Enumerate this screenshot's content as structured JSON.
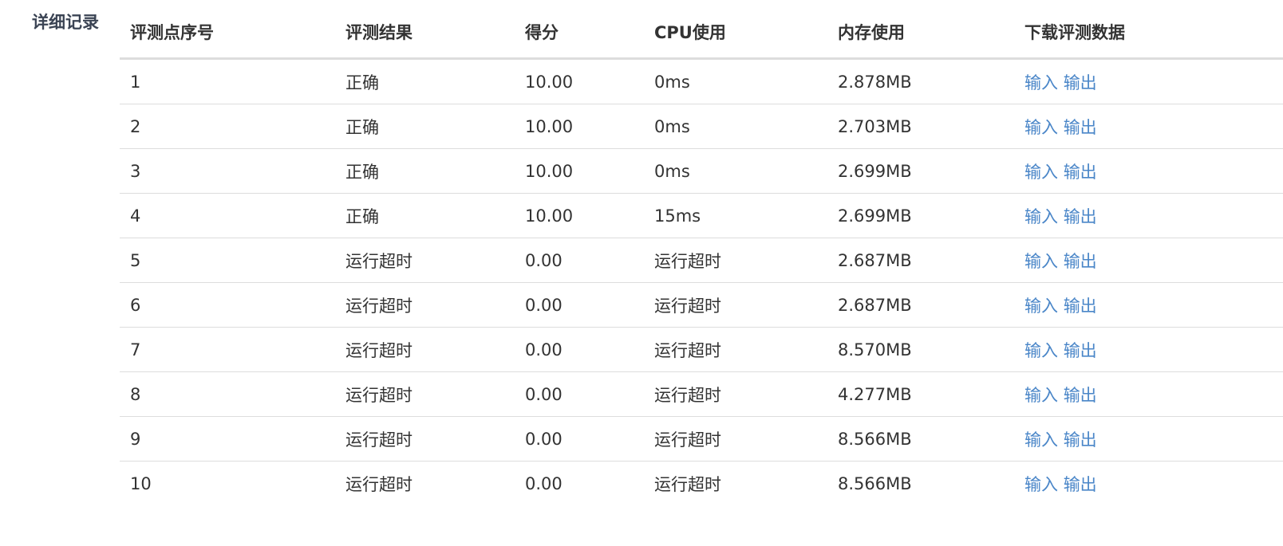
{
  "section_label": "详细记录",
  "link_color": "#4a86c8",
  "table": {
    "headers": [
      "评测点序号",
      "评测结果",
      "得分",
      "CPU使用",
      "内存使用",
      "下载评测数据"
    ],
    "input_label": "输入",
    "output_label": "输出",
    "rows": [
      {
        "index": "1",
        "result": "正确",
        "score": "10.00",
        "cpu": "0ms",
        "memory": "2.878MB"
      },
      {
        "index": "2",
        "result": "正确",
        "score": "10.00",
        "cpu": "0ms",
        "memory": "2.703MB"
      },
      {
        "index": "3",
        "result": "正确",
        "score": "10.00",
        "cpu": "0ms",
        "memory": "2.699MB"
      },
      {
        "index": "4",
        "result": "正确",
        "score": "10.00",
        "cpu": "15ms",
        "memory": "2.699MB"
      },
      {
        "index": "5",
        "result": "运行超时",
        "score": "0.00",
        "cpu": "运行超时",
        "memory": "2.687MB"
      },
      {
        "index": "6",
        "result": "运行超时",
        "score": "0.00",
        "cpu": "运行超时",
        "memory": "2.687MB"
      },
      {
        "index": "7",
        "result": "运行超时",
        "score": "0.00",
        "cpu": "运行超时",
        "memory": "8.570MB"
      },
      {
        "index": "8",
        "result": "运行超时",
        "score": "0.00",
        "cpu": "运行超时",
        "memory": "4.277MB"
      },
      {
        "index": "9",
        "result": "运行超时",
        "score": "0.00",
        "cpu": "运行超时",
        "memory": "8.566MB"
      },
      {
        "index": "10",
        "result": "运行超时",
        "score": "0.00",
        "cpu": "运行超时",
        "memory": "8.566MB"
      }
    ]
  }
}
